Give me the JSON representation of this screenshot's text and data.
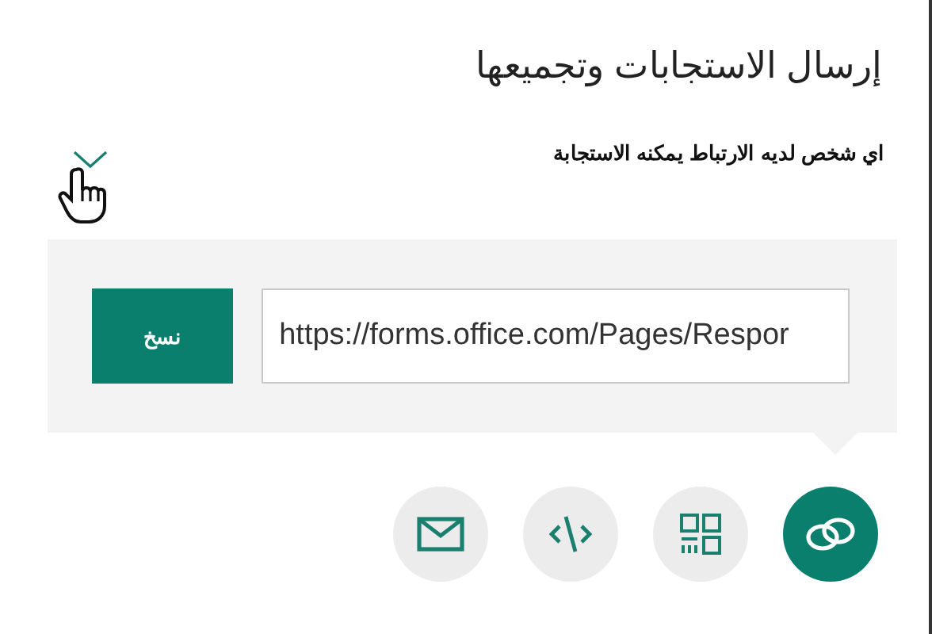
{
  "title": "إرسال الاستجابات وتجميعها",
  "audience": "اي شخص لديه الارتباط يمكنه الاستجابة",
  "link_field": {
    "value": "https://forms.office.com/Pages/Respor"
  },
  "copy_button": "نسخ",
  "share_options": [
    {
      "kind": "link",
      "selected": true
    },
    {
      "kind": "qr",
      "selected": false
    },
    {
      "kind": "embed",
      "selected": false
    },
    {
      "kind": "email",
      "selected": false
    }
  ]
}
